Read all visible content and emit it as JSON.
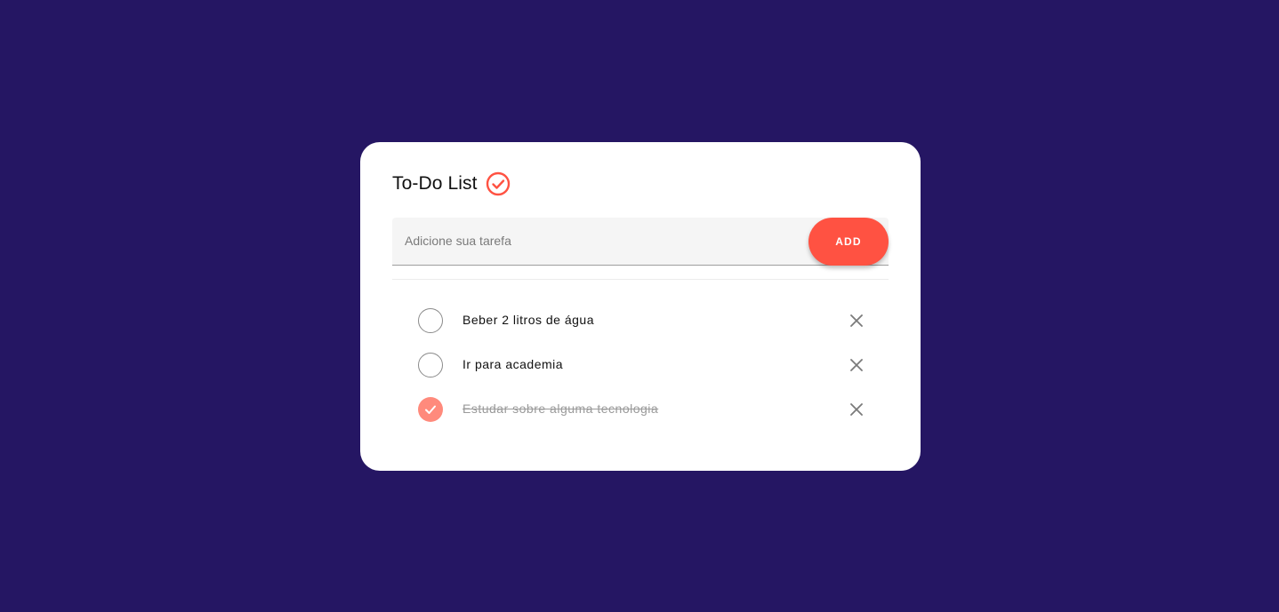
{
  "app": {
    "title": "To-Do List",
    "title_icon": "check-circle-icon"
  },
  "input": {
    "placeholder": "Adicione sua tarefa",
    "value": ""
  },
  "add_button": {
    "label": "ADD"
  },
  "tasks": [
    {
      "text": "Beber 2 litros de água",
      "completed": false
    },
    {
      "text": "Ir para academia",
      "completed": false
    },
    {
      "text": "Estudar sobre alguma tecnologia",
      "completed": true
    }
  ],
  "colors": {
    "background": "#251663",
    "accent": "#ff5242",
    "completed_check": "#ff8a7c",
    "card": "#ffffff"
  }
}
